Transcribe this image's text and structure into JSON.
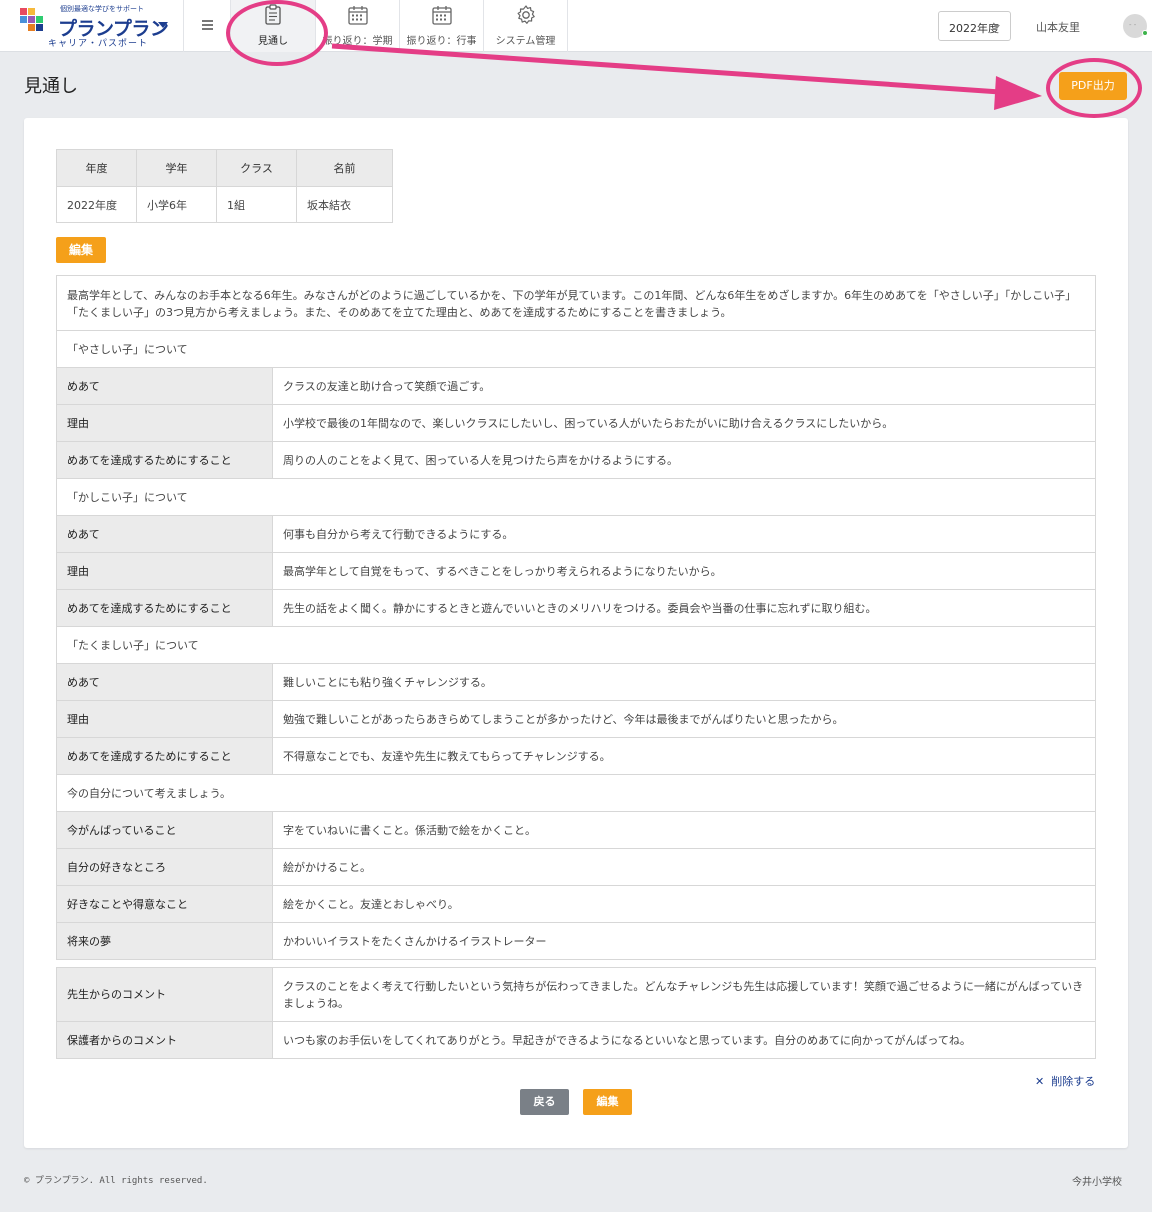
{
  "header": {
    "logo": {
      "tagline": "個別最適な学びをサポート",
      "name": "プランプラン",
      "subtitle": "キャリア・パスポート"
    },
    "nav": [
      {
        "label": "見通し",
        "icon": "clipboard-icon",
        "active": true
      },
      {
        "label": "振り返り：学期",
        "icon": "calendar-icon",
        "active": false
      },
      {
        "label": "振り返り：行事",
        "icon": "calendar-icon",
        "active": false
      },
      {
        "label": "システム管理",
        "icon": "gear-icon",
        "active": false
      }
    ],
    "year_select": "2022年度",
    "user_name": "山本友里"
  },
  "page": {
    "title": "見通し",
    "pdf_button": "PDF出力"
  },
  "info_table": {
    "headers": [
      "年度",
      "学年",
      "クラス",
      "名前"
    ],
    "values": [
      "2022年度",
      "小学6年",
      "1組",
      "坂本結衣"
    ]
  },
  "edit_button": "編集",
  "main": {
    "intro": "最高学年として、みんなのお手本となる6年生。みなさんがどのように過ごしているかを、下の学年が見ています。この1年間、どんな6年生をめざしますか。6年生のめあてを「やさしい子」「かしこい子」「たくましい子」の3つ見方から考えましょう。また、そのめあてを立てた理由と、めあてを達成するためにすることを書きましょう。",
    "sections": [
      {
        "title": "「やさしい子」について",
        "rows": [
          {
            "label": "めあて",
            "value": "クラスの友達と助け合って笑顔で過ごす。"
          },
          {
            "label": "理由",
            "value": "小学校で最後の1年間なので、楽しいクラスにしたいし、困っている人がいたらおたがいに助け合えるクラスにしたいから。"
          },
          {
            "label": "めあてを達成するためにすること",
            "value": "周りの人のことをよく見て、困っている人を見つけたら声をかけるようにする。"
          }
        ]
      },
      {
        "title": "「かしこい子」について",
        "rows": [
          {
            "label": "めあて",
            "value": "何事も自分から考えて行動できるようにする。"
          },
          {
            "label": "理由",
            "value": "最高学年として自覚をもって、するべきことをしっかり考えられるようになりたいから。"
          },
          {
            "label": "めあてを達成するためにすること",
            "value": "先生の話をよく聞く。静かにするときと遊んでいいときのメリハリをつける。委員会や当番の仕事に忘れずに取り組む。"
          }
        ]
      },
      {
        "title": "「たくましい子」について",
        "rows": [
          {
            "label": "めあて",
            "value": "難しいことにも粘り強くチャレンジする。"
          },
          {
            "label": "理由",
            "value": "勉強で難しいことがあったらあきらめてしまうことが多かったけど、今年は最後までがんばりたいと思ったから。"
          },
          {
            "label": "めあてを達成するためにすること",
            "value": "不得意なことでも、友達や先生に教えてもらってチャレンジする。"
          }
        ]
      },
      {
        "title": "今の自分について考えましょう。",
        "rows": [
          {
            "label": "今がんばっていること",
            "value": "字をていねいに書くこと。係活動で絵をかくこと。"
          },
          {
            "label": "自分の好きなところ",
            "value": "絵がかけること。"
          },
          {
            "label": "好きなことや得意なこと",
            "value": "絵をかくこと。友達とおしゃべり。"
          },
          {
            "label": "将来の夢",
            "value": "かわいいイラストをたくさんかけるイラストレーター"
          }
        ]
      }
    ]
  },
  "comments": [
    {
      "label": "先生からのコメント",
      "value": "クラスのことをよく考えて行動したいという気持ちが伝わってきました。どんなチャレンジも先生は応援しています！笑顔で過ごせるように一緒にがんばっていきましょうね。"
    },
    {
      "label": "保護者からのコメント",
      "value": "いつも家のお手伝いをしてくれてありがとう。早起きができるようになるといいなと思っています。自分のめあてに向かってがんばってね。"
    }
  ],
  "actions": {
    "delete": "削除する",
    "back": "戻る",
    "edit": "編集"
  },
  "footer": {
    "copyright": "© プランプラン. All rights reserved.",
    "school": "今井小学校"
  },
  "colors": {
    "accent_orange": "#f5a01a",
    "brand_navy": "#1c3d8f",
    "annotation_pink": "#e43d86",
    "back_gray": "#7a8087"
  }
}
